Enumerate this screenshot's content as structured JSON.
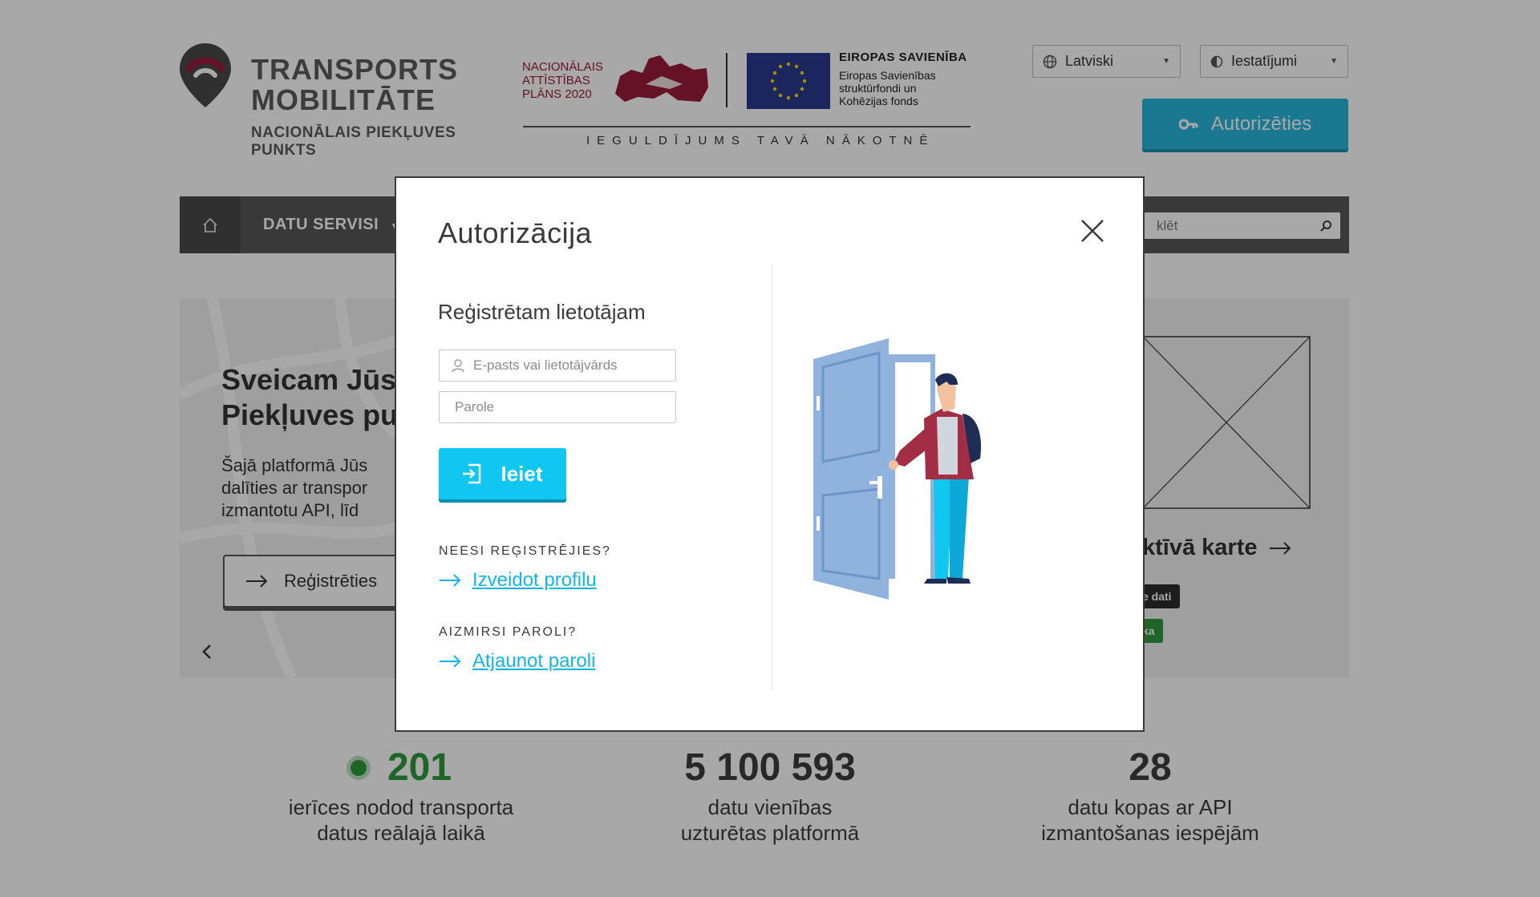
{
  "header": {
    "logo_line1": "TRANSPORTS",
    "logo_line2": "MOBILITĀTE",
    "logo_sub_line1": "NACIONĀLAIS PIEKĻUVES",
    "logo_sub_line2": "PUNKTS",
    "nap_line1": "NACIONĀLAIS",
    "nap_line2": "ATTĪSTĪBAS",
    "nap_line3": "PLĀNS 2020",
    "eu_title": "EIROPAS SAVIENĪBA",
    "eu_line1": "Eiropas Savienības",
    "eu_line2": "struktūrfondi un",
    "eu_line3": "Kohēzijas fonds",
    "tagline": "IEGULDĪJUMS TAVĀ NĀKOTNĒ",
    "language": "Latviski",
    "settings": "Iestatījumi",
    "auth_button": "Autorizēties"
  },
  "nav": {
    "item1": "DATU SERVISI",
    "search_placeholder": "Meklēt",
    "search_visible": "klēt"
  },
  "hero": {
    "title_line1": "Sveicam Jūs",
    "title_line2": "Piekļuves pu",
    "text_line1": "Šajā platformā Jūs",
    "text_line2": "dalīties ar transpor",
    "text_line3": "izmantotu API, līd",
    "register_button": "Reģistrēties",
    "card_title": "ktīvā karte",
    "badge1": "e dati",
    "badge2": "ka"
  },
  "stats": [
    {
      "value": "201",
      "label_line1": "ierīces nodod transporta",
      "label_line2": "datus reālajā laikā"
    },
    {
      "value": "5 100 593",
      "label_line1": "datu vienības",
      "label_line2": "uzturētas platformā"
    },
    {
      "value": "28",
      "label_line1": "datu kopas ar API",
      "label_line2": "izmantošanas iespējām"
    }
  ],
  "modal": {
    "title": "Autorizācija",
    "subtitle": "Reģistrētam lietotājam",
    "email_placeholder": "E-pasts vai lietotājvārds",
    "password_placeholder": "Parole",
    "login_button": "Ieiet",
    "not_registered": "NEESI REĢISTRĒJIES?",
    "create_profile": "Izveidot profilu",
    "forgot_password": "AIZMIRSI PAROLI?",
    "restore_password": "Atjaunot paroli"
  },
  "colors": {
    "accent": "#0fc7f0",
    "auth_button": "#2ab7dd",
    "brand_red": "#9a1c3a",
    "eu_blue": "#2a3a8f",
    "live_green": "#2e9a3e"
  }
}
